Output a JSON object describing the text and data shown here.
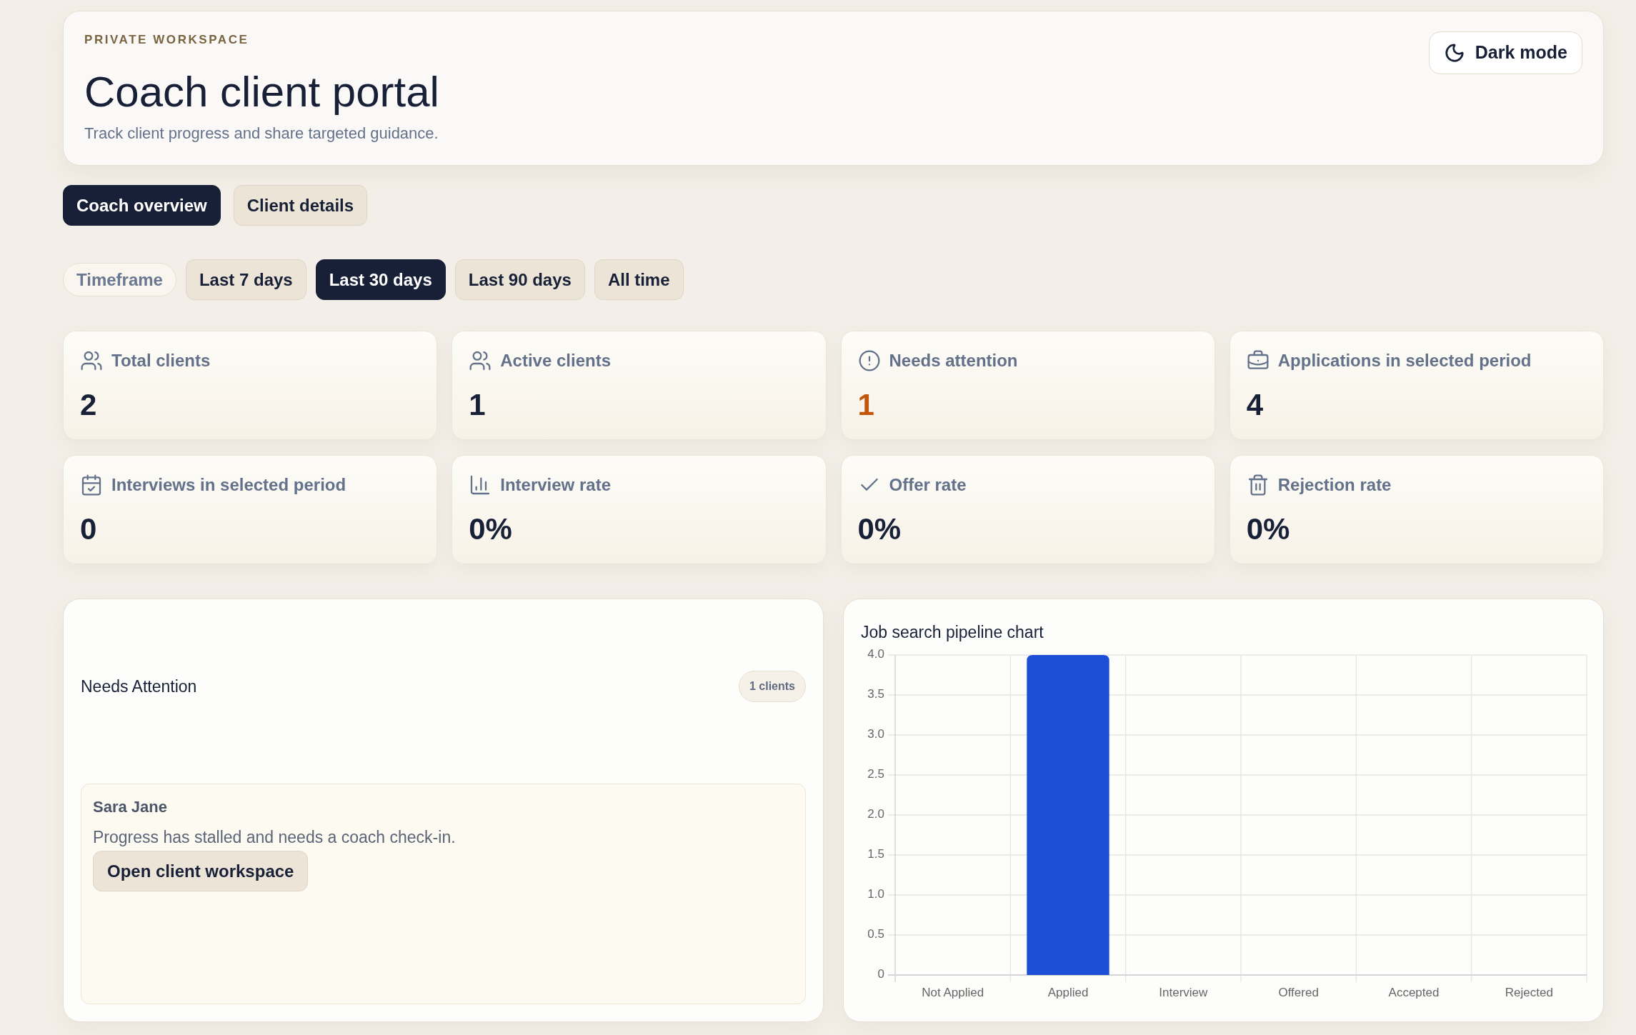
{
  "header": {
    "eyebrow": "PRIVATE WORKSPACE",
    "title": "Coach client portal",
    "subtitle": "Track client progress and share targeted guidance.",
    "theme_button": "Dark mode"
  },
  "tabs": [
    {
      "label": "Coach overview",
      "selected": true
    },
    {
      "label": "Client details",
      "selected": false
    }
  ],
  "timeframe": {
    "label": "Timeframe",
    "options": [
      {
        "label": "Last 7 days",
        "selected": false
      },
      {
        "label": "Last 30 days",
        "selected": true
      },
      {
        "label": "Last 90 days",
        "selected": false
      },
      {
        "label": "All time",
        "selected": false
      }
    ]
  },
  "stats": [
    {
      "label": "Total clients",
      "value": "2",
      "alert": false
    },
    {
      "label": "Active clients",
      "value": "1",
      "alert": false
    },
    {
      "label": "Needs attention",
      "value": "1",
      "alert": true
    },
    {
      "label": "Applications in selected period",
      "value": "4",
      "alert": false
    },
    {
      "label": "Interviews in selected period",
      "value": "0",
      "alert": false
    },
    {
      "label": "Interview rate",
      "value": "0%",
      "alert": false
    },
    {
      "label": "Offer rate",
      "value": "0%",
      "alert": false
    },
    {
      "label": "Rejection rate",
      "value": "0%",
      "alert": false
    }
  ],
  "needs_attention": {
    "title": "Needs Attention",
    "count": "1 clients",
    "clients": [
      {
        "name": "Sara Jane",
        "note": "Progress has stalled and needs a coach check-in.",
        "action": "Open client workspace"
      }
    ]
  },
  "pipeline": {
    "chart_data": {
      "type": "bar",
      "title": "Job search pipeline chart",
      "categories": [
        "Not Applied",
        "Applied",
        "Interview",
        "Offered",
        "Accepted",
        "Rejected"
      ],
      "series": [
        {
          "color": "#1d4ed8",
          "values": [
            0,
            4,
            0,
            0,
            0,
            0
          ]
        }
      ],
      "ylim": [
        0,
        4
      ],
      "yticks": [
        0,
        0.5,
        {
          "value": 1,
          "label": "1.0"
        },
        1.5,
        {
          "value": 2,
          "label": "2.0"
        },
        2.5,
        {
          "value": 3,
          "label": "3.0"
        },
        3.5,
        {
          "value": 4,
          "label": "4.0"
        }
      ],
      "grid": true
    }
  }
}
